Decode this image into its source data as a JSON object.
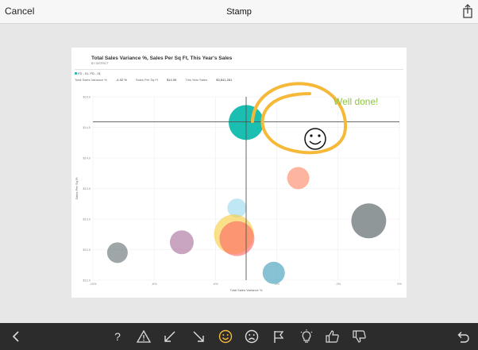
{
  "header": {
    "cancel_label": "Cancel",
    "title": "Stamp"
  },
  "report": {
    "title": "Total Sales Variance %, Sales Per Sq Ft, This Year's Sales",
    "subtitle": "BY DISTRICT",
    "filter_label": "FD - 01, FD - 01",
    "kpis": [
      {
        "label": "Total Sales Variance %",
        "value": "-4.92 %"
      },
      {
        "label": "Sales Per Sq Ft",
        "value": "$14.59"
      },
      {
        "label": "This Year Sales",
        "value": "$3,841,281"
      }
    ]
  },
  "annotation": {
    "text": "Well done!",
    "text_color": "#8dc63f",
    "circle_color": "#f6b838"
  },
  "chart_data": {
    "type": "scatter",
    "xlabel": "Total Sales Variance %",
    "ylabel": "Sales Per Sq Ft",
    "xlim": [
      -10,
      0
    ],
    "ylim": [
      12,
      15
    ],
    "x_ticks": [
      "-10%",
      "-8%",
      "-6%",
      "-4%",
      "-2%",
      "0%"
    ],
    "y_ticks": [
      "$12.0",
      "$12.5",
      "$13.0",
      "$13.5",
      "$14.0",
      "$14.5",
      "$15.0"
    ],
    "crosshair": {
      "x": -5.0,
      "y": 14.59
    },
    "points": [
      {
        "x": -5.0,
        "y": 14.58,
        "r": 22,
        "color": "#01b8aa",
        "opacity": 0.9
      },
      {
        "x": -3.3,
        "y": 13.67,
        "r": 14,
        "color": "#fd8d6b",
        "opacity": 0.65
      },
      {
        "x": -1.0,
        "y": 12.97,
        "r": 22,
        "color": "#5f6b6d",
        "opacity": 0.7
      },
      {
        "x": -5.3,
        "y": 13.18,
        "r": 12,
        "color": "#8ad4eb",
        "opacity": 0.55
      },
      {
        "x": -5.4,
        "y": 12.75,
        "r": 25,
        "color": "#f7d04a",
        "opacity": 0.65
      },
      {
        "x": -5.3,
        "y": 12.68,
        "r": 22,
        "color": "#fd6261",
        "opacity": 0.6
      },
      {
        "x": -7.1,
        "y": 12.62,
        "r": 15,
        "color": "#a66999",
        "opacity": 0.6
      },
      {
        "x": -9.2,
        "y": 12.45,
        "r": 13,
        "color": "#5f6b6d",
        "opacity": 0.6
      },
      {
        "x": -4.1,
        "y": 12.12,
        "r": 14,
        "color": "#3599b8",
        "opacity": 0.6
      }
    ]
  },
  "toolbar": {
    "icons": [
      "back-icon",
      "question-icon",
      "warning-icon",
      "arrow-down-left-icon",
      "arrow-down-right-icon",
      "smiley-icon",
      "sad-face-icon",
      "flag-icon",
      "lightbulb-icon",
      "thumbs-up-icon",
      "thumbs-down-icon",
      "undo-icon"
    ],
    "active_icon": "smiley-icon",
    "active_color": "#f6b838"
  }
}
